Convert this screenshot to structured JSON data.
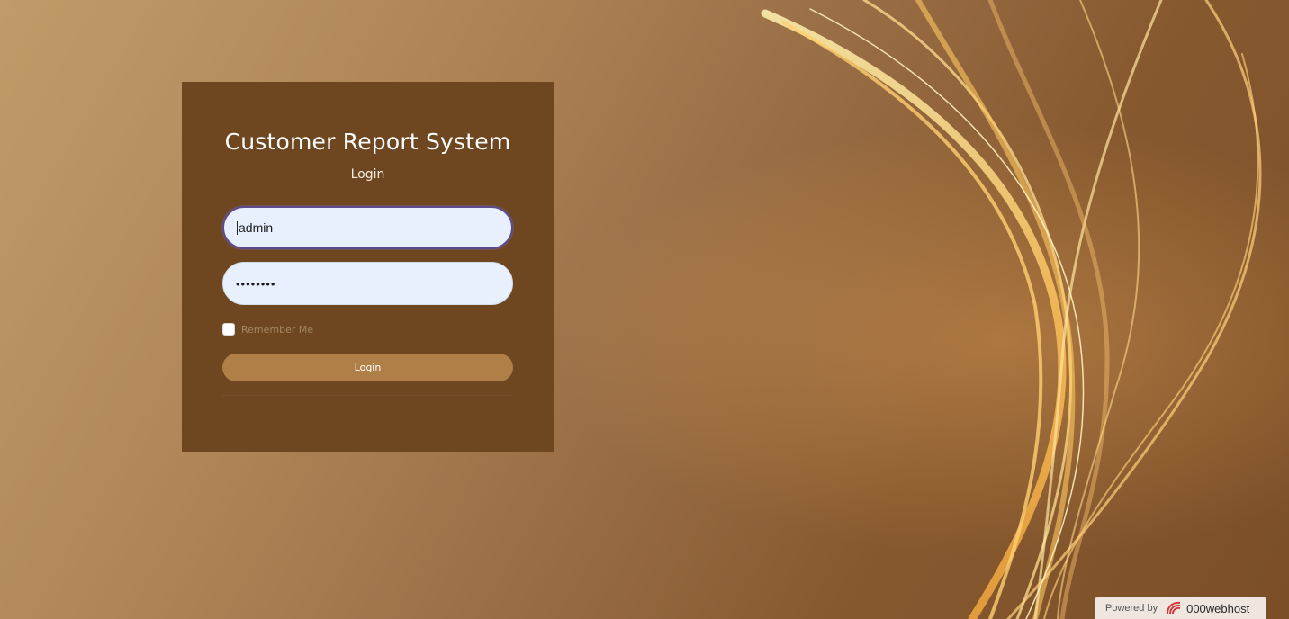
{
  "login_card": {
    "title": "Customer Report System",
    "subtitle": "Login",
    "username_value": "admin",
    "password_value": "••••••••",
    "remember_label": "Remember Me",
    "remember_checked": false,
    "login_button_label": "Login"
  },
  "footer_badge": {
    "powered_label": "Powered by",
    "host_name": "000webhost",
    "logo_icon": "000webhost-logo-icon"
  },
  "colors": {
    "card_background": "#6e4720",
    "button_background": "#b07f48",
    "input_background": "#e8f0fe"
  }
}
